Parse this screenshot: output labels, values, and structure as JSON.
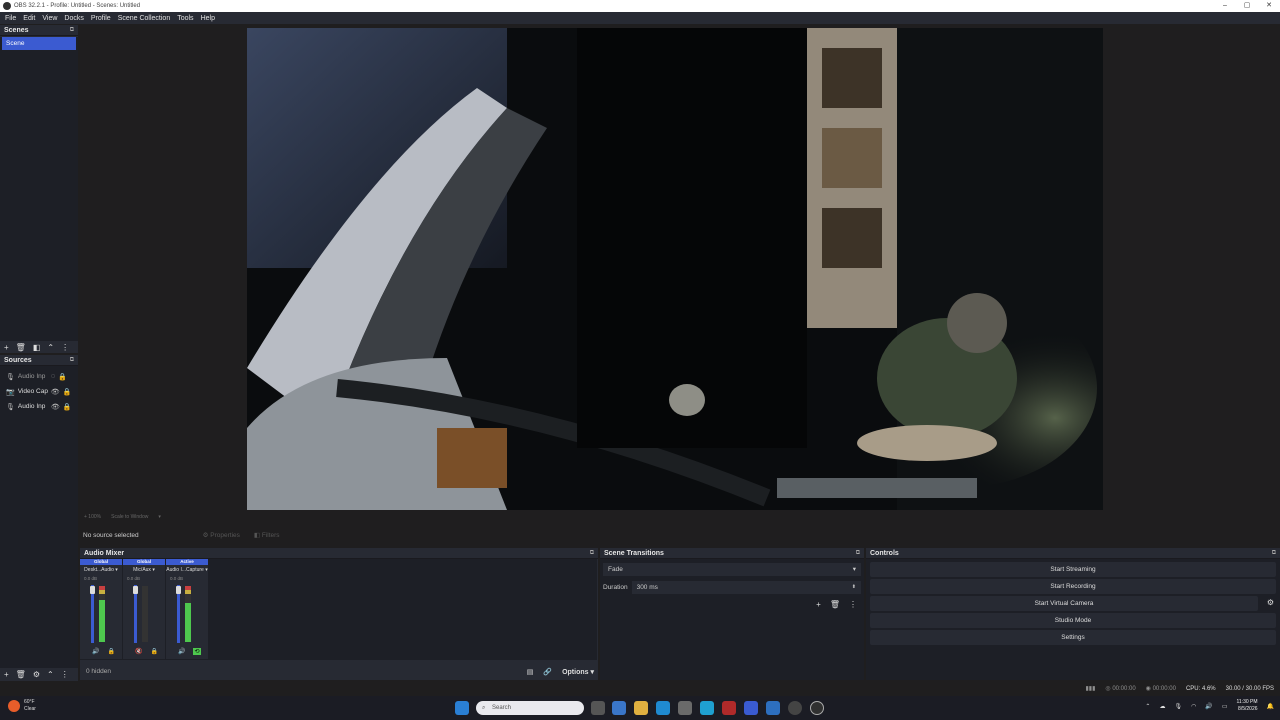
{
  "window": {
    "title": "OBS 32.2.1 - Profile: Untitled - Scenes: Untitled",
    "controls": [
      "–",
      "▢",
      "✕"
    ]
  },
  "menu": [
    "File",
    "Edit",
    "View",
    "Docks",
    "Profile",
    "Scene Collection",
    "Tools",
    "Help"
  ],
  "scenes": {
    "title": "Scenes",
    "items": [
      "Scene"
    ]
  },
  "sources": {
    "title": "Sources",
    "items": [
      {
        "label": "Audio Inp",
        "icon": "mic-icon",
        "visible": false
      },
      {
        "label": "Video Cap",
        "icon": "camera-icon",
        "visible": true
      },
      {
        "label": "Audio Inp",
        "icon": "mic-icon",
        "visible": true
      }
    ],
    "hidden_count": "0 hidden"
  },
  "under_preview": {
    "a": "+ 100%",
    "b": "Scale to Window"
  },
  "context": {
    "selected": "No source selected",
    "properties": "Properties",
    "filters": "Filters"
  },
  "mixer": {
    "title": "Audio Mixer",
    "channels": [
      {
        "tag": "Global",
        "name": "Deskt...Audio",
        "db": "0.0 dB"
      },
      {
        "tag": "Global",
        "name": "Mic/Aux",
        "db": "0.0 dB"
      },
      {
        "tag": "Active",
        "name": "Audio I...Capture",
        "db": "0.0 dB"
      }
    ],
    "options": "Options"
  },
  "transitions": {
    "title": "Scene Transitions",
    "type": "Fade",
    "duration_label": "Duration",
    "duration_value": "300 ms"
  },
  "controls": {
    "title": "Controls",
    "buttons": [
      "Start Streaming",
      "Start Recording",
      "Start Virtual Camera",
      "Studio Mode",
      "Settings"
    ]
  },
  "status": {
    "t1": "00:00:00",
    "t2": "00:00:00",
    "cpu": "CPU: 4.6%",
    "fps": "30.00 / 30.00 FPS"
  },
  "taskbar": {
    "weather_temp": "60°F",
    "weather_desc": "Clear",
    "search": "Search",
    "time": "11:30 PM",
    "date": "8/5/2026"
  },
  "colors": {
    "accent": "#3b5bd1",
    "panel": "#272a33",
    "background": "#1d1f26"
  }
}
